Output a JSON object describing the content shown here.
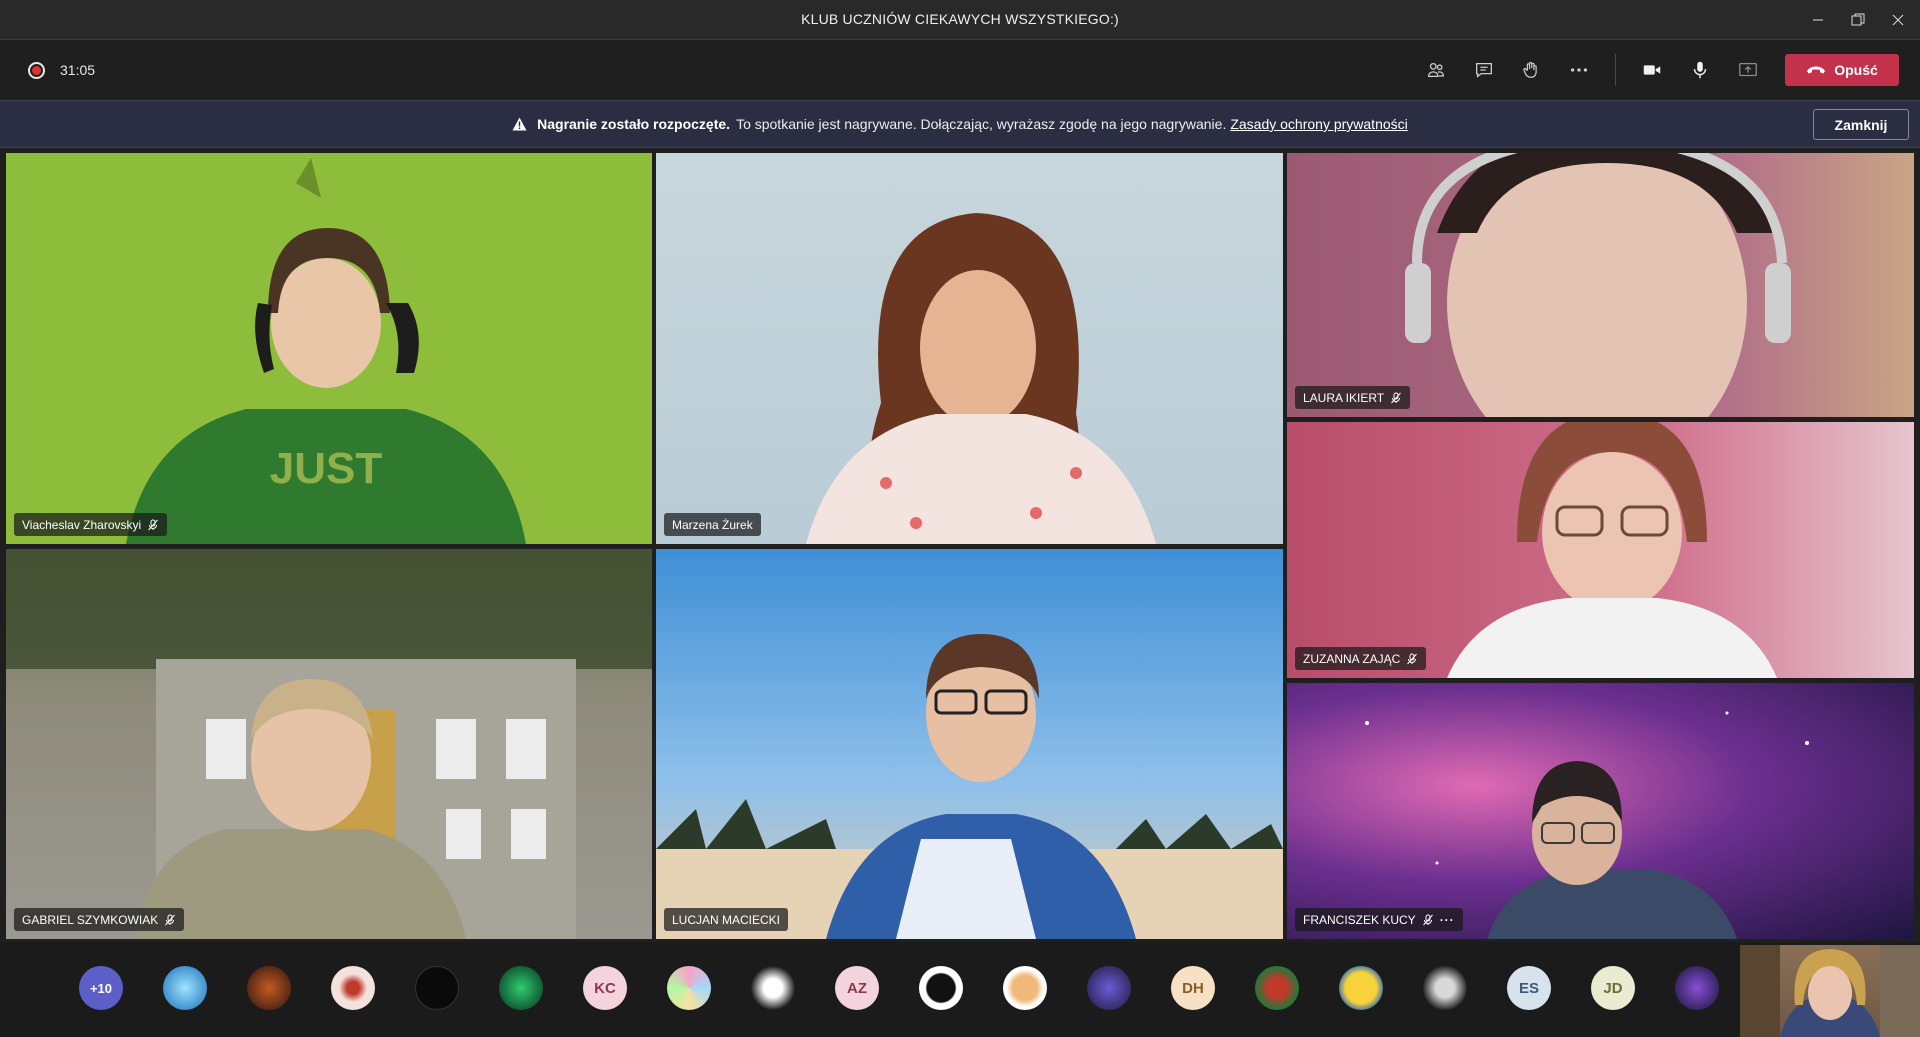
{
  "window": {
    "title": "KLUB UCZNIÓW CIEKAWYCH WSZYSTKIEGO:)"
  },
  "toolbar": {
    "timer": "31:05",
    "leave_label": "Opuść"
  },
  "banner": {
    "bold": "Nagranie zostało rozpoczęte.",
    "text": "To spotkanie jest nagrywane. Dołączając, wyrażasz zgodę na jego nagrywanie.",
    "link": "Zasady ochrony prywatności",
    "close_label": "Zamknij"
  },
  "tiles": [
    {
      "name": "Viacheslav Zharovskyi",
      "muted": true
    },
    {
      "name": "Marzena Żurek",
      "muted": false
    },
    {
      "name": "LAURA IKIERT",
      "muted": true
    },
    {
      "name": "ZUZANNA ZAJĄC",
      "muted": true
    },
    {
      "name": "FRANCISZEK KUCY",
      "muted": true
    },
    {
      "name": "GABRIEL SZYMKOWIAK",
      "muted": true
    },
    {
      "name": "LUCJAN MACIECKI",
      "muted": false
    }
  ],
  "strip": {
    "overflow": "+10",
    "initials": [
      "KC",
      "AZ",
      "DH",
      "ES",
      "JD"
    ]
  },
  "colors": {
    "leave": "#c4314b",
    "banner": "#2b2d42",
    "overflow_avatar": "#5b5fc7"
  }
}
